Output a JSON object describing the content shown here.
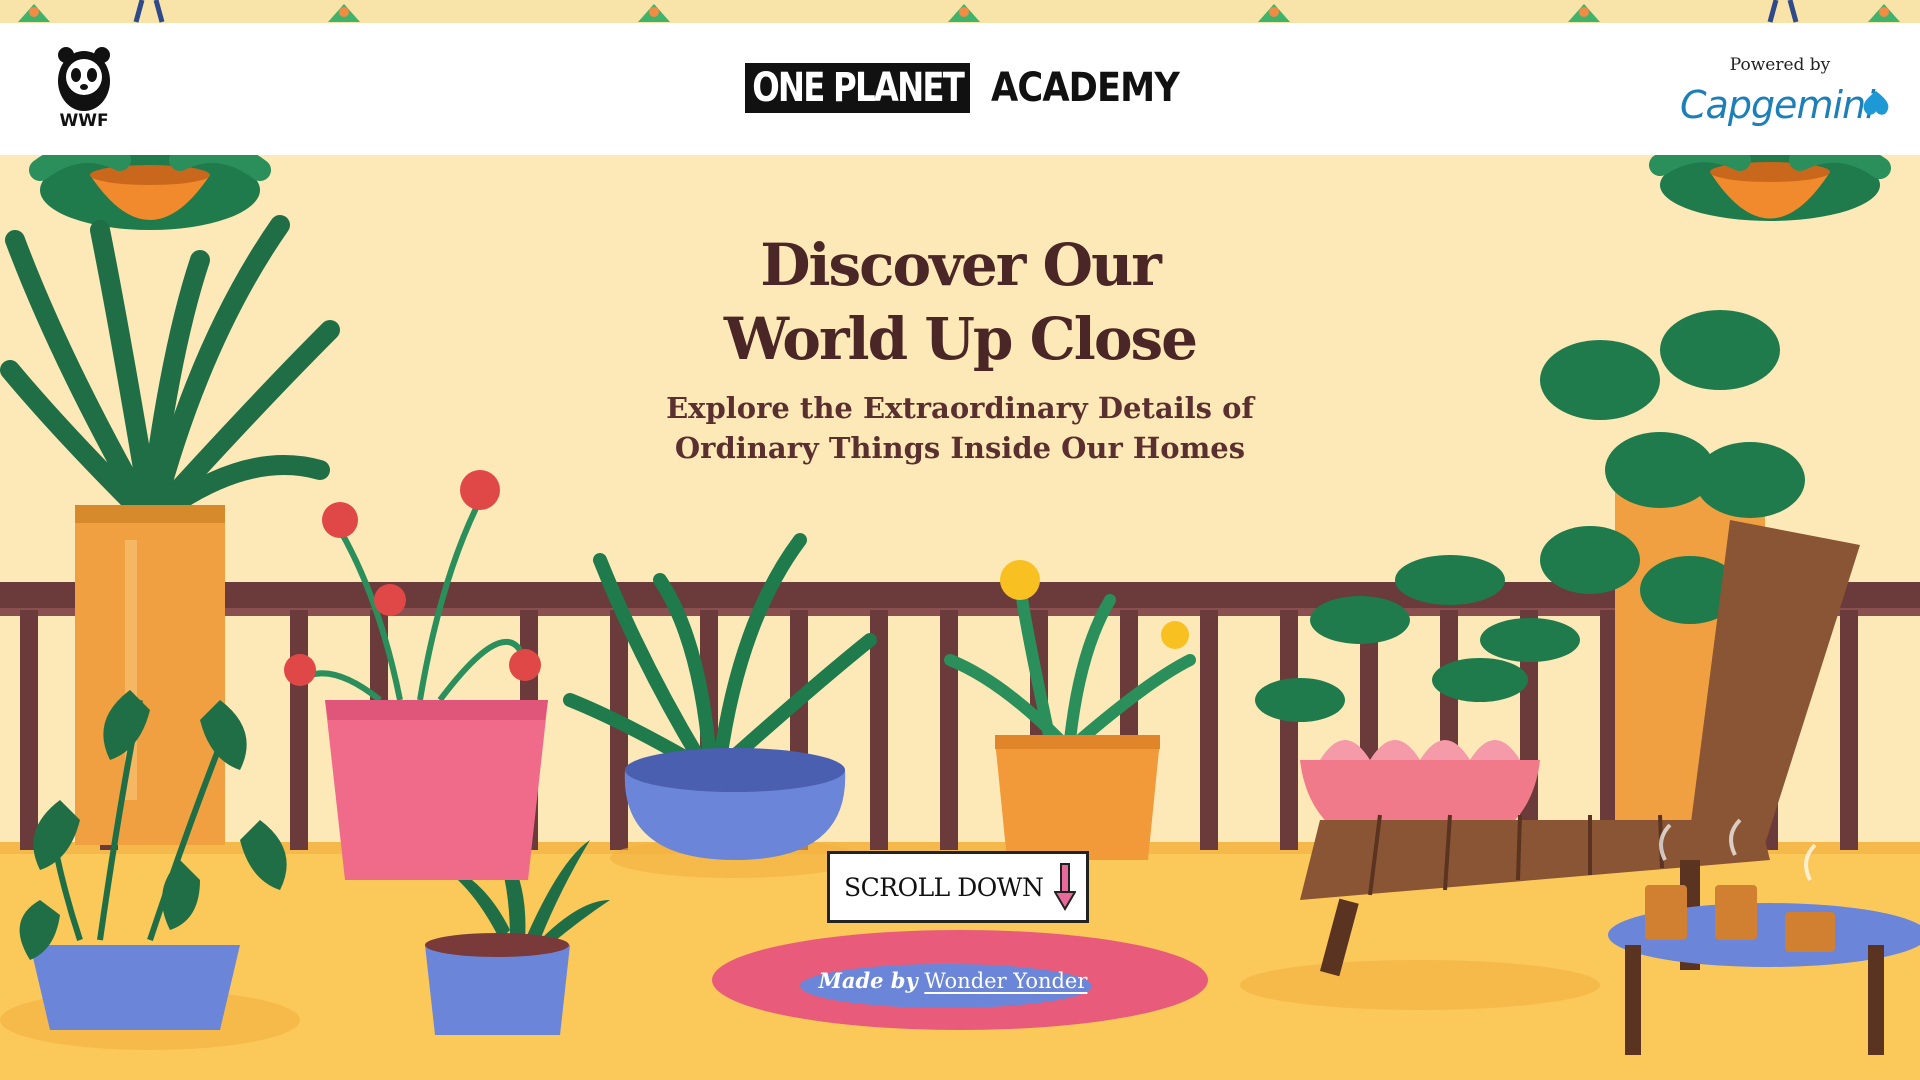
{
  "header": {
    "wwf_label": "WWF",
    "brand_box": "ONE PLANET",
    "brand_text": "ACADEMY",
    "powered_by": "Powered by",
    "sponsor": "Capgemini"
  },
  "hero": {
    "title_line1": "Discover Our",
    "title_line2": "World Up Close",
    "subtitle_line1": "Explore the Extraordinary Details of",
    "subtitle_line2": "Ordinary Things Inside Our Homes"
  },
  "scroll_button": {
    "label": "SCROLL DOWN"
  },
  "credit": {
    "prefix": "Made by",
    "link": "Wonder Yonder"
  },
  "colors": {
    "background": "#fde9b8",
    "floor": "#fbc85a",
    "railing": "#6b3a3a",
    "title": "#4a2626",
    "capgemini_blue": "#1d7fb8"
  }
}
